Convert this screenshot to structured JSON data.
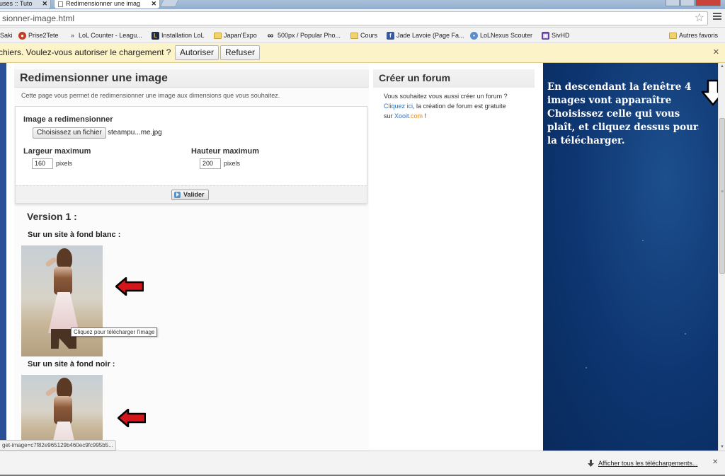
{
  "browser": {
    "tabs": [
      {
        "label": "uses :: Tuto",
        "close": "✕"
      },
      {
        "label": "Redimensionner une imag",
        "close": "✕"
      }
    ],
    "url": "sionner-image.html",
    "bookmarks": [
      {
        "label": "Saki",
        "icon": "none"
      },
      {
        "label": "Prise2Tete",
        "icon": "red-circle-icon"
      },
      {
        "label": "LoL Counter - Leagu...",
        "icon": "arrow-icon"
      },
      {
        "label": "Installation LoL",
        "icon": "lol-icon"
      },
      {
        "label": "Japan'Expo",
        "icon": "folder-icon"
      },
      {
        "label": "500px / Popular Pho...",
        "icon": "infinity-icon"
      },
      {
        "label": "Cours",
        "icon": "folder-icon"
      },
      {
        "label": "Jade Lavoie (Page Fa...",
        "icon": "facebook-icon"
      },
      {
        "label": "LoLNexus Scouter",
        "icon": "lolnexus-icon"
      },
      {
        "label": "SivHD",
        "icon": "twitch-icon"
      }
    ],
    "other_bookmarks": "Autres favoris",
    "infobar": {
      "message": "chiers. Voulez-vous autoriser le chargement ?",
      "allow": "Autoriser",
      "refuse": "Refuser",
      "close": "✕"
    }
  },
  "main": {
    "title": "Redimensionner une image",
    "description": "Cette page vous permet de redimensionner une image aux dimensions que vous souhaitez.",
    "form": {
      "image_label": "Image a redimensionner",
      "file_button": "Choisissez un fichier",
      "file_name": "steampu...me.jpg",
      "width_label": "Largeur maximum",
      "width_value": "160",
      "height_label": "Hauteur maximum",
      "height_value": "200",
      "unit": "pixels",
      "submit": "Valider"
    },
    "version_title": "Version 1 :",
    "white_bg_title": "Sur un site à fond blanc :",
    "black_bg_title": "Sur un site à fond noir :",
    "tooltip": "Cliquez pour télécharger l'image"
  },
  "side": {
    "title": "Créer un forum",
    "text_1": "Vous souhaitez vous aussi créer un forum ?",
    "link": "Cliquez ici",
    "text_2": ", la création de forum est gratuite",
    "text_3": "sur ",
    "brand_a": "Xooit",
    "brand_b": ".com",
    "text_4": " !"
  },
  "overlay": {
    "text": "En descendant la fenêtre 4 images vont apparaître Choisissez celle qui vous plaît, et cliquez dessus pour la télécharger."
  },
  "status_url": "get-image=c7f82e965129b460ec9fc995b5...",
  "downloads": {
    "show_all": "Afficher tous les téléchargements...",
    "close": "✕"
  },
  "colors": {
    "arrow_red": "#d2161b",
    "panel_blue": "#0d3570",
    "link_blue": "#2e6fb6",
    "brand_orange": "#e8861c",
    "infobar_yellow": "#fdf3c8"
  }
}
